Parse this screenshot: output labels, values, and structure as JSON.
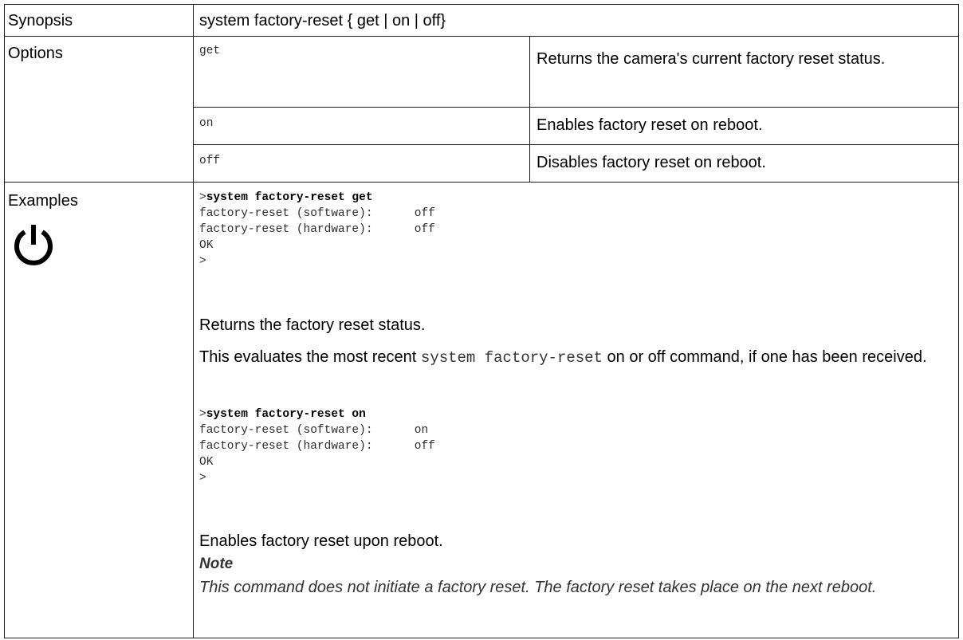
{
  "synopsis": {
    "label": "Synopsis",
    "text": "system factory-reset { get | on | off}"
  },
  "options": {
    "label": "Options",
    "rows": [
      {
        "option": "get",
        "description": "Returns the camera's current factory reset status."
      },
      {
        "option": "on",
        "description": "Enables factory reset on reboot."
      },
      {
        "option": "off",
        "description": "Disables factory reset on reboot."
      }
    ]
  },
  "examples": {
    "label": "Examples",
    "icon": "power-icon",
    "example1": {
      "prompt": ">",
      "command": "system factory-reset get",
      "lines": [
        "factory-reset (software):      off",
        "factory-reset (hardware):      off",
        "OK",
        ">"
      ],
      "description": "Returns the factory reset status.",
      "detail_before": "This evaluates the most recent ",
      "detail_code": "system factory-reset",
      "detail_after": " on or off command, if one has been received."
    },
    "example2": {
      "prompt": ">",
      "command": "system factory-reset on",
      "lines": [
        "factory-reset (software):      on",
        "factory-reset (hardware):      off",
        "OK",
        ">"
      ],
      "description": "Enables factory reset upon reboot."
    },
    "note": {
      "heading": "Note",
      "text": "This command does not initiate a factory reset. The factory reset takes place on the next reboot."
    }
  }
}
